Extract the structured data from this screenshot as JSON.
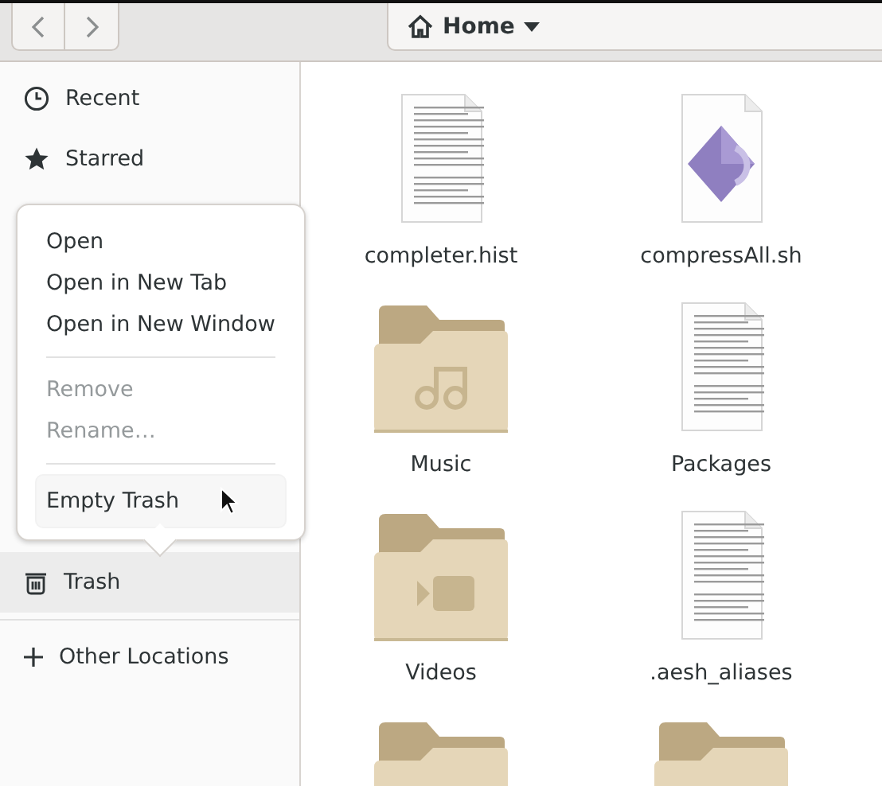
{
  "header": {
    "nav_buttons": [
      {
        "kind": "back"
      },
      {
        "kind": "forward"
      }
    ],
    "path": {
      "label": "Home"
    }
  },
  "sidebar": {
    "places": [
      {
        "kind": "recent",
        "label": "Recent",
        "selected": false
      },
      {
        "kind": "starred",
        "label": "Starred",
        "selected": false
      }
    ],
    "trash": {
      "label": "Trash",
      "selected": true
    },
    "other_locations": {
      "label": "Other Locations"
    }
  },
  "context_menu": {
    "items": [
      {
        "kind": "item",
        "label": "Open",
        "disabled": false,
        "selected": false
      },
      {
        "kind": "item",
        "label": "Open in New Tab",
        "disabled": false,
        "selected": false
      },
      {
        "kind": "item",
        "label": "Open in New Window",
        "disabled": false,
        "selected": false
      },
      {
        "kind": "separator"
      },
      {
        "kind": "item",
        "label": "Remove",
        "disabled": true,
        "selected": false
      },
      {
        "kind": "item",
        "label": "Rename…",
        "disabled": true,
        "selected": false
      },
      {
        "kind": "separator"
      },
      {
        "kind": "item",
        "label": "Empty Trash",
        "disabled": false,
        "selected": true
      }
    ]
  },
  "files": [
    {
      "kind": "text",
      "name": "completer.hist"
    },
    {
      "kind": "script",
      "name": "compressAll.sh"
    },
    {
      "kind": "music-folder",
      "name": "Music"
    },
    {
      "kind": "text",
      "name": "Packages"
    },
    {
      "kind": "video-folder",
      "name": "Videos"
    },
    {
      "kind": "text",
      "name": ".aesh_aliases"
    },
    {
      "kind": "folder"
    },
    {
      "kind": "folder"
    }
  ]
}
